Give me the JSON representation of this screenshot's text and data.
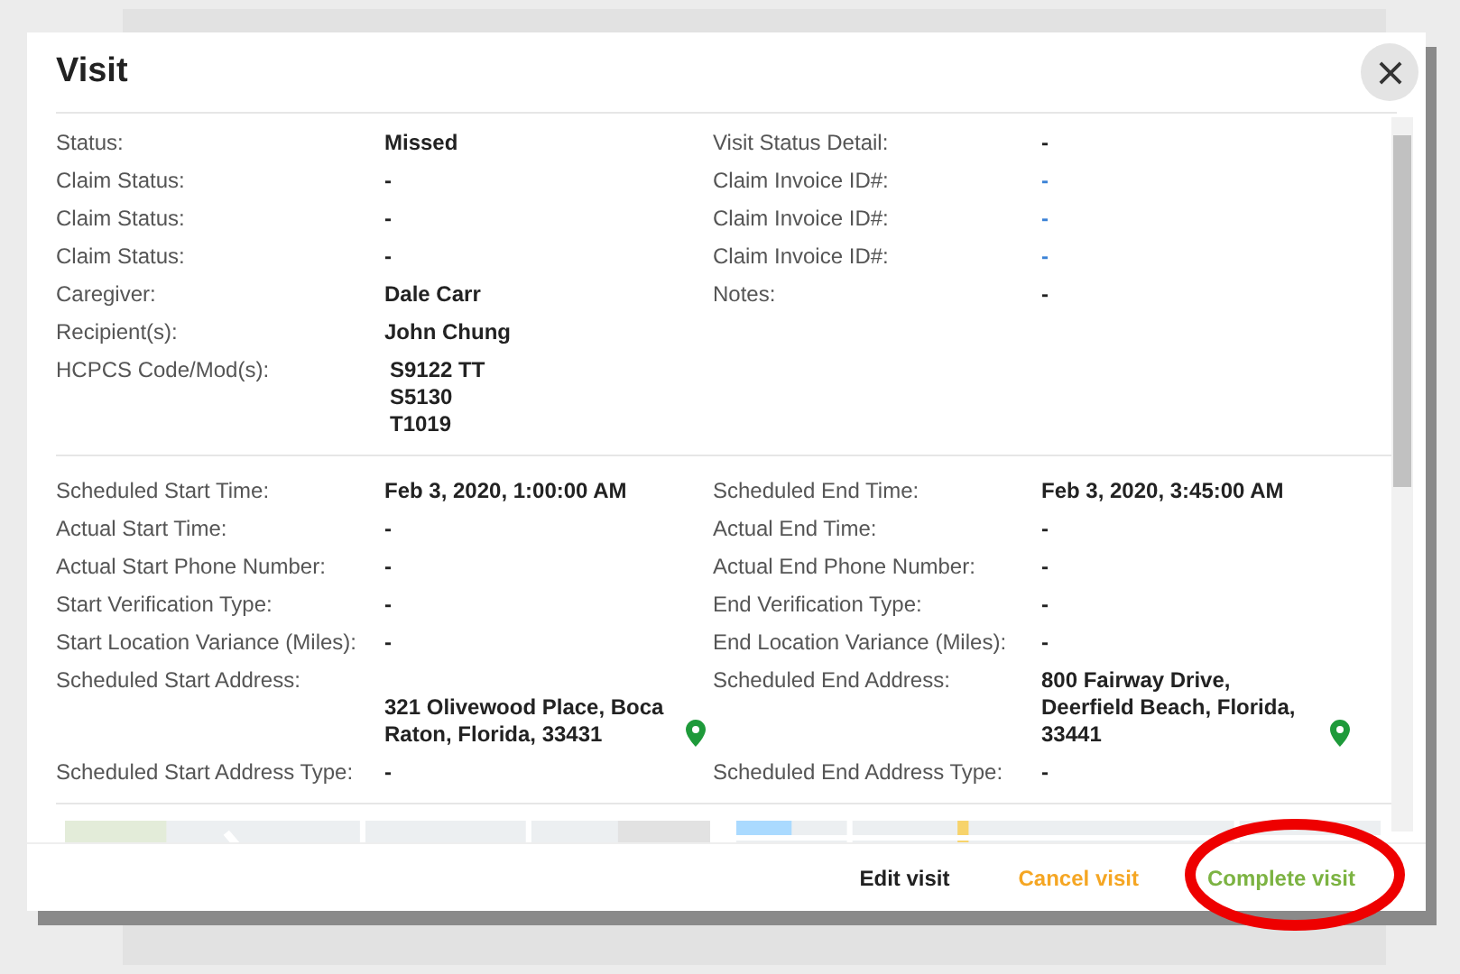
{
  "dialog": {
    "title": "Visit"
  },
  "sections": [
    {
      "rows": [
        {
          "left": {
            "label": "Status:",
            "kind": "text",
            "value": "Missed"
          },
          "right": {
            "label": "Visit Status Detail:",
            "kind": "text",
            "value": "-"
          }
        },
        {
          "left": {
            "label": "Claim Status:",
            "kind": "text",
            "value": "-"
          },
          "right": {
            "label": "Claim Invoice ID#:",
            "kind": "link",
            "value": "-"
          }
        },
        {
          "left": {
            "label": "Claim Status:",
            "kind": "text",
            "value": "-"
          },
          "right": {
            "label": "Claim Invoice ID#:",
            "kind": "link",
            "value": "-"
          }
        },
        {
          "left": {
            "label": "Claim Status:",
            "kind": "text",
            "value": "-"
          },
          "right": {
            "label": "Claim Invoice ID#:",
            "kind": "link",
            "value": "-"
          }
        },
        {
          "left": {
            "label": "Caregiver:",
            "kind": "text",
            "value": "Dale Carr"
          },
          "right": {
            "label": "Notes:",
            "kind": "text",
            "value": "-"
          }
        },
        {
          "left": {
            "label": "Recipient(s):",
            "kind": "text",
            "value": "John Chung"
          }
        },
        {
          "left": {
            "label": "HCPCS Code/Mod(s):",
            "kind": "lines",
            "lines": [
              "S9122 TT",
              "S5130",
              "T1019"
            ]
          }
        }
      ]
    },
    {
      "rows": [
        {
          "left": {
            "label": "Scheduled Start Time:",
            "kind": "text",
            "value": "Feb 3, 2020, 1:00:00 AM"
          },
          "right": {
            "label": "Scheduled End Time:",
            "kind": "text",
            "value": "Feb 3, 2020, 3:45:00 AM"
          }
        },
        {
          "left": {
            "label": "Actual Start Time:",
            "kind": "text",
            "value": "-"
          },
          "right": {
            "label": "Actual End Time:",
            "kind": "text",
            "value": "-"
          }
        },
        {
          "left": {
            "label": "Actual Start Phone Number:",
            "kind": "text",
            "value": "-"
          },
          "right": {
            "label": "Actual End Phone Number:",
            "kind": "text",
            "value": "-"
          }
        },
        {
          "left": {
            "label": "Start Verification Type:",
            "kind": "text",
            "value": "-"
          },
          "right": {
            "label": "End Verification Type:",
            "kind": "text",
            "value": "-"
          }
        },
        {
          "left": {
            "label": "Start Location Variance (Miles):",
            "kind": "text",
            "value": "-"
          },
          "right": {
            "label": "End Location Variance (Miles):",
            "kind": "text",
            "value": "-"
          }
        },
        {
          "left": {
            "label": "Scheduled Start Address:",
            "kind": "address",
            "value": "321 Olivewood Place, Boca Raton, Florida, 33431"
          },
          "right": {
            "label": "Scheduled End Address:",
            "kind": "address",
            "value": "800 Fairway Drive, Deerfield Beach, Florida, 33441"
          }
        },
        {
          "left": {
            "label": "Scheduled Start Address Type:",
            "kind": "text",
            "value": "-"
          },
          "right": {
            "label": "Scheduled End Address Type:",
            "kind": "text",
            "value": "-"
          }
        }
      ]
    }
  ],
  "footer_buttons": [
    {
      "label": "Edit visit",
      "color": "#212121"
    },
    {
      "label": "Cancel visit",
      "color": "#f5a623"
    },
    {
      "label": "Complete visit",
      "color": "#7cb342"
    }
  ]
}
